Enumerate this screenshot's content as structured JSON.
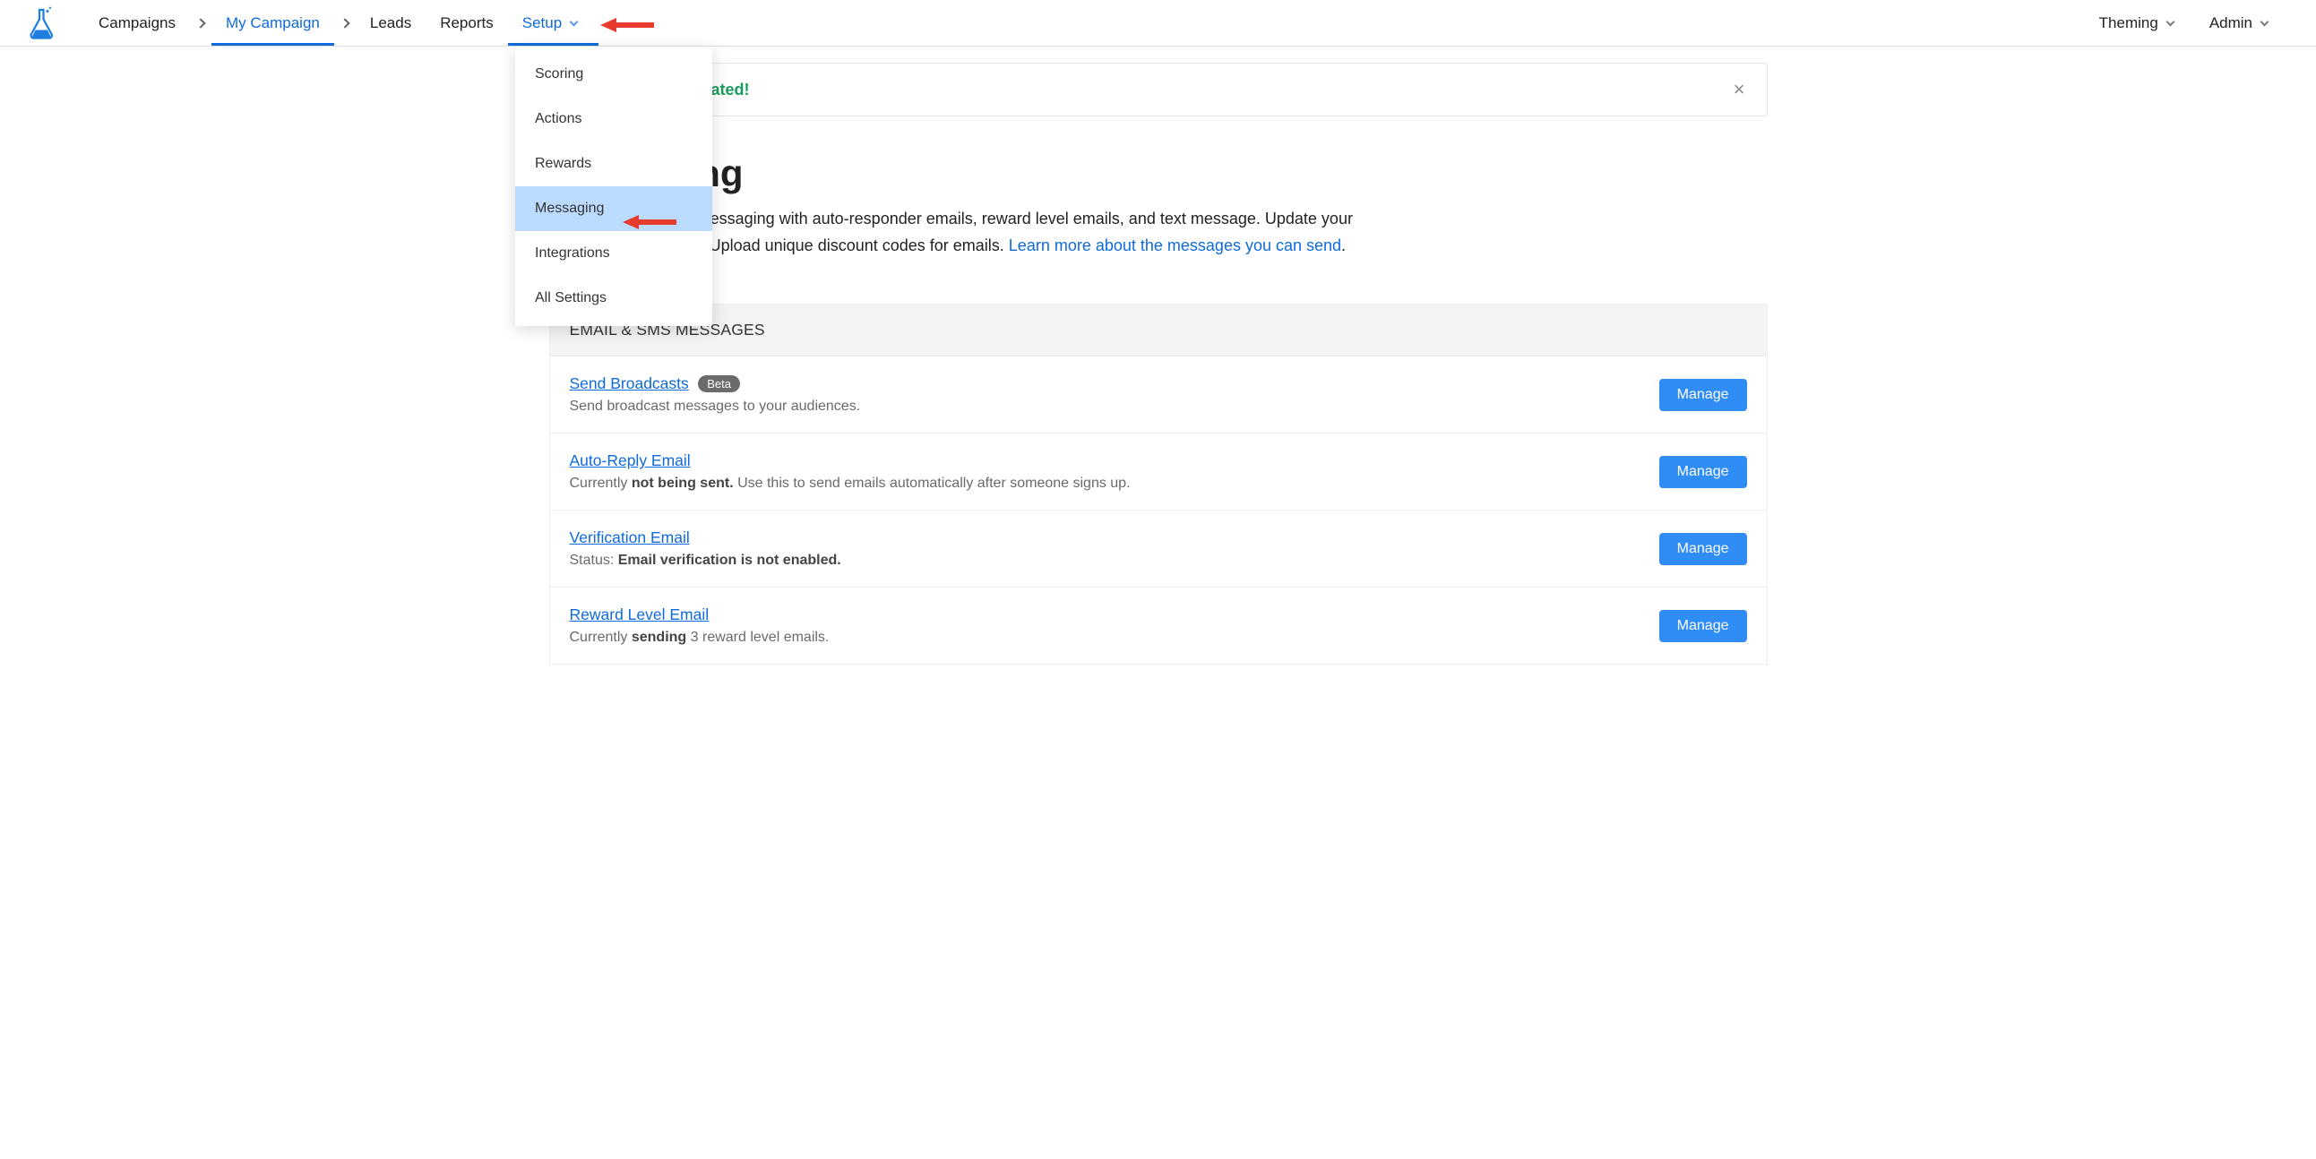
{
  "nav": {
    "campaigns": "Campaigns",
    "my_campaign": "My Campaign",
    "leads": "Leads",
    "reports": "Reports",
    "setup": "Setup",
    "theming": "Theming",
    "admin": "Admin"
  },
  "dropdown": {
    "items": [
      {
        "label": "Scoring"
      },
      {
        "label": "Actions"
      },
      {
        "label": "Rewards"
      },
      {
        "label": "Messaging"
      },
      {
        "label": "Integrations"
      },
      {
        "label": "All Settings"
      }
    ]
  },
  "alert": {
    "text": "Email settings updated!",
    "close": "×"
  },
  "page": {
    "title": "Messaging",
    "desc_1": "Automate campaign messaging with auto-responder emails, reward level emails, and text message. Update your default email settings. Upload unique discount codes for emails. ",
    "desc_link": "Learn more about the messages you can send",
    "desc_2": "."
  },
  "section": {
    "header": "EMAIL & SMS MESSAGES"
  },
  "rows": [
    {
      "title": "Send Broadcasts",
      "badge": "Beta",
      "desc_pre": "Send broadcast messages to your audiences.",
      "desc_bold": "",
      "desc_post": "",
      "btn": "Manage"
    },
    {
      "title": "Auto-Reply Email",
      "badge": null,
      "desc_pre": "Currently ",
      "desc_bold": "not being sent.",
      "desc_post": " Use this to send emails automatically after someone signs up.",
      "btn": "Manage"
    },
    {
      "title": "Verification Email",
      "badge": null,
      "desc_pre": "Status: ",
      "desc_bold": "Email verification is not enabled.",
      "desc_post": "",
      "btn": "Manage"
    },
    {
      "title": "Reward Level Email",
      "badge": null,
      "desc_pre": "Currently ",
      "desc_bold": "sending",
      "desc_post": " 3 reward level emails.",
      "btn": "Manage"
    }
  ]
}
